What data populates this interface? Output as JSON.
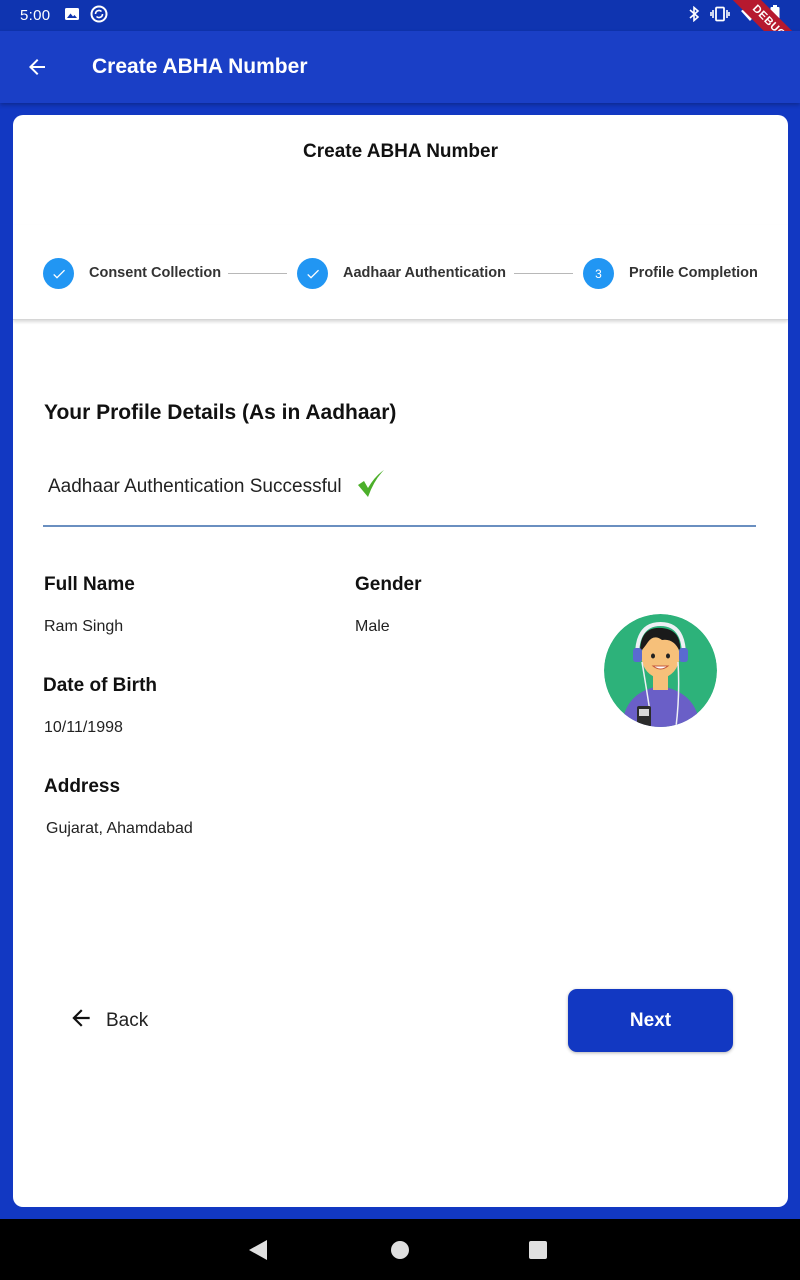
{
  "status_bar": {
    "time": "5:00",
    "debug_label": "DEBUG",
    "icons": [
      "image-icon",
      "sync-icon",
      "bluetooth-icon",
      "vibrate-icon",
      "wifi-icon",
      "battery-icon"
    ]
  },
  "app_bar": {
    "title": "Create ABHA Number",
    "back_icon": "arrow-back-icon"
  },
  "card": {
    "title": "Create ABHA Number"
  },
  "stepper": {
    "steps": [
      {
        "label": "Consent Collection",
        "state": "done"
      },
      {
        "label": "Aadhaar Authentication",
        "state": "done"
      },
      {
        "label": "Profile Completion",
        "state": "active",
        "number": "3"
      }
    ]
  },
  "profile": {
    "section_title": "Your Profile Details (As in Aadhaar)",
    "auth_status": "Aadhaar Authentication Successful",
    "full_name_label": "Full Name",
    "full_name": "Ram Singh",
    "gender_label": "Gender",
    "gender": "Male",
    "dob_label": "Date of Birth",
    "dob": "10/11/1998",
    "address_label": "Address",
    "address": "Gujarat, Ahamdabad"
  },
  "actions": {
    "back_label": "Back",
    "next_label": "Next"
  },
  "colors": {
    "primary": "#1238c2",
    "step_circle": "#2196f3",
    "success_check": "#4caf2a",
    "avatar_bg": "#2db27a"
  }
}
